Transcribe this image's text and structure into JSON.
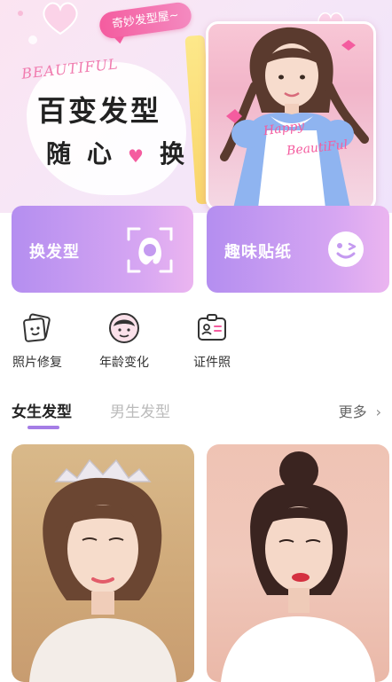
{
  "hero": {
    "bubble_text": "奇妙发型屋~",
    "decor_word": "BEAUTIFUL",
    "slogan_line1": "百变发型",
    "slogan_line2_a": "随",
    "slogan_line2_b": "心",
    "slogan_line2_c": "换",
    "photo_text1": "Happy",
    "photo_text2": "BeautiFul"
  },
  "features": [
    {
      "label": "换发型",
      "icon": "face-scan-icon"
    },
    {
      "label": "趣味贴纸",
      "icon": "wink-face-icon"
    }
  ],
  "tools": [
    {
      "label": "照片修复",
      "icon": "photo-repair-icon"
    },
    {
      "label": "年龄变化",
      "icon": "age-face-icon"
    },
    {
      "label": "证件照",
      "icon": "id-card-icon"
    }
  ],
  "tabs": {
    "active": "女生发型",
    "inactive": "男生发型",
    "more": "更多"
  },
  "colors": {
    "accent_purple": "#a57de6",
    "pink": "#f45c9f"
  }
}
